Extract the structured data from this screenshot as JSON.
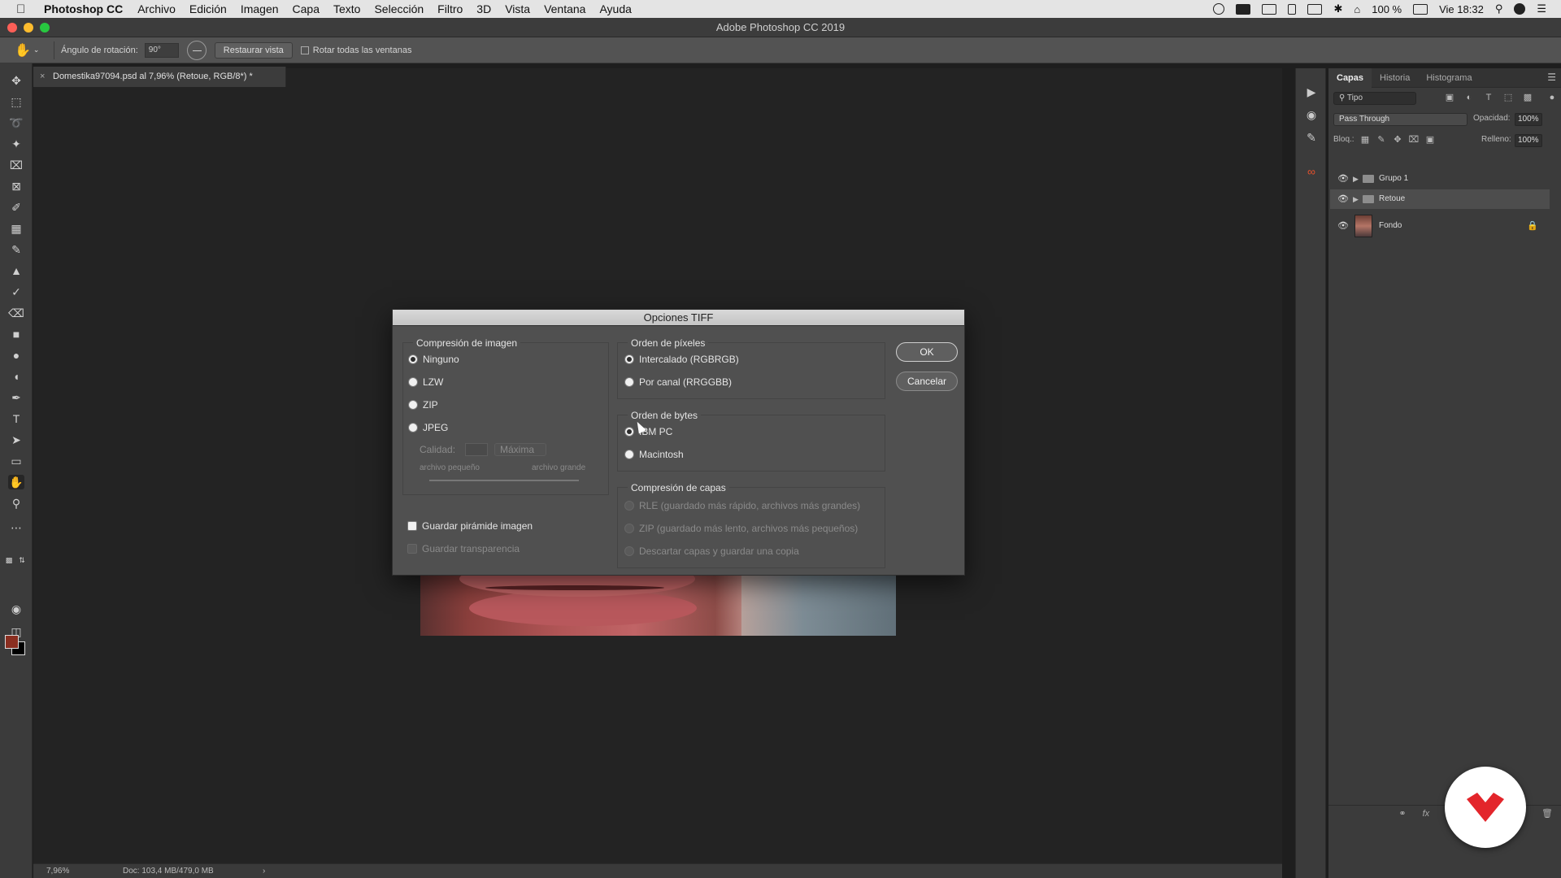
{
  "menubar": {
    "app_name": "Photoshop CC",
    "items": [
      "Archivo",
      "Edición",
      "Imagen",
      "Capa",
      "Texto",
      "Selección",
      "Filtro",
      "3D",
      "Vista",
      "Ventana",
      "Ayuda"
    ],
    "battery": "100 %",
    "clock": "Vie 18:32"
  },
  "window": {
    "title": "Adobe Photoshop CC 2019"
  },
  "options_bar": {
    "rotation_label": "Ángulo de rotación:",
    "rotation_value": "90°",
    "reset_view": "Restaurar vista",
    "rotate_all": "Rotar todas las ventanas"
  },
  "document": {
    "tab_title": "Domestika97094.psd al 7,96% (Retoue, RGB/8*) *",
    "zoom": "7,96%",
    "doc_info": "Doc: 103,4 MB/479,0 MB"
  },
  "layers_panel": {
    "tabs": [
      "Capas",
      "Historia",
      "Histograma"
    ],
    "filter": "Tipo",
    "blend_mode": "Pass Through",
    "opacity_label": "Opacidad:",
    "opacity_value": "100%",
    "lock_label": "Bloq.:",
    "fill_label": "Relleno:",
    "fill_value": "100%",
    "layers": [
      {
        "name": "Grupo 1",
        "type": "group",
        "selected": false
      },
      {
        "name": "Retoue",
        "type": "group",
        "selected": true
      },
      {
        "name": "Fondo",
        "type": "image",
        "locked": true
      }
    ]
  },
  "dialog": {
    "title": "Opciones TIFF",
    "compression": {
      "title": "Compresión de imagen",
      "options": [
        "Ninguno",
        "LZW",
        "ZIP",
        "JPEG"
      ],
      "selected": "Ninguno",
      "quality_label": "Calidad:",
      "quality_select": "Máxima",
      "small_file": "archivo pequeño",
      "large_file": "archivo grande"
    },
    "pixel_order": {
      "title": "Orden de píxeles",
      "options": [
        "Intercalado (RGBRGB)",
        "Por canal (RRGGBB)"
      ],
      "selected": "Intercalado (RGBRGB)"
    },
    "byte_order": {
      "title": "Orden de bytes",
      "options": [
        "IBM PC",
        "Macintosh"
      ],
      "selected": "IBM PC"
    },
    "layer_compression": {
      "title": "Compresión de capas",
      "options": [
        "RLE (guardado más rápido, archivos más grandes)",
        "ZIP (guardado más lento, archivos más pequeños)",
        "Descartar capas y guardar una copia"
      ]
    },
    "save_pyramid": "Guardar pirámide imagen",
    "save_transparency": "Guardar transparencia",
    "ok": "OK",
    "cancel": "Cancelar"
  },
  "colors": {
    "foreground": "#8a2e20",
    "background": "#000000",
    "brand": "#e3252b"
  }
}
